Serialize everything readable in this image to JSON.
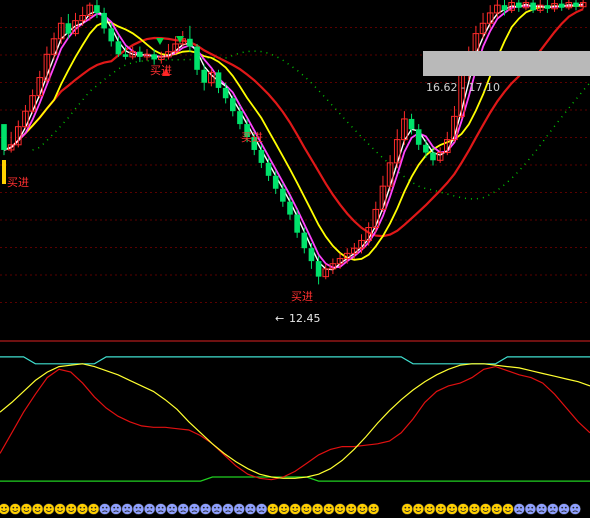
{
  "chart_data": {
    "type": "candlestick",
    "price_panel": {
      "ylim": [
        11.8,
        17.95
      ],
      "low_marker": "12.45",
      "range_box": "16.62 - 17.10",
      "signal_label": "买进",
      "up_candle_color": "#ff2b2b",
      "down_candle_color": "#00e26b",
      "candles": [
        [
          15.55,
          15.05,
          15.2,
          14.95
        ],
        [
          15.05,
          15.15,
          15.4,
          15.0
        ],
        [
          15.15,
          15.5,
          15.62,
          15.1
        ],
        [
          15.5,
          15.8,
          15.92,
          15.45
        ],
        [
          15.8,
          16.1,
          16.22,
          15.75
        ],
        [
          16.1,
          16.45,
          16.58,
          16.05
        ],
        [
          16.4,
          16.9,
          17.05,
          16.35
        ],
        [
          16.9,
          17.2,
          17.32,
          16.8
        ],
        [
          17.2,
          17.5,
          17.62,
          17.1
        ],
        [
          17.5,
          17.3,
          17.68,
          17.2
        ],
        [
          17.3,
          17.55,
          17.7,
          17.25
        ],
        [
          17.55,
          17.65,
          17.82,
          17.45
        ],
        [
          17.65,
          17.85,
          17.9,
          17.55
        ],
        [
          17.85,
          17.7,
          17.95,
          17.6
        ],
        [
          17.7,
          17.4,
          17.8,
          17.3
        ],
        [
          17.4,
          17.15,
          17.5,
          17.05
        ],
        [
          17.15,
          16.9,
          17.25,
          16.85
        ],
        [
          16.9,
          16.85,
          17.05,
          16.8
        ],
        [
          16.85,
          16.95,
          17.05,
          16.8
        ],
        [
          16.95,
          16.85,
          17.05,
          16.75
        ],
        [
          16.85,
          16.9,
          17.0,
          16.78
        ],
        [
          16.9,
          16.8,
          17.0,
          16.7
        ],
        [
          16.8,
          16.85,
          16.95,
          16.72
        ],
        [
          16.85,
          16.95,
          17.1,
          16.8
        ],
        [
          16.95,
          17.1,
          17.25,
          16.9
        ],
        [
          17.1,
          17.2,
          17.35,
          17.05
        ],
        [
          17.2,
          17.05,
          17.45,
          16.95
        ],
        [
          17.05,
          16.6,
          17.1,
          16.5
        ],
        [
          16.6,
          16.35,
          16.7,
          16.2
        ],
        [
          16.35,
          16.55,
          16.62,
          16.28
        ],
        [
          16.55,
          16.25,
          16.6,
          16.15
        ],
        [
          16.25,
          16.05,
          16.35,
          15.95
        ],
        [
          16.05,
          15.8,
          16.1,
          15.7
        ],
        [
          15.8,
          15.55,
          15.9,
          15.45
        ],
        [
          15.55,
          15.3,
          15.65,
          15.2
        ],
        [
          15.3,
          15.05,
          15.4,
          14.95
        ],
        [
          15.05,
          14.8,
          15.15,
          14.7
        ],
        [
          14.8,
          14.55,
          14.9,
          14.45
        ],
        [
          14.55,
          14.3,
          14.65,
          14.2
        ],
        [
          14.3,
          14.05,
          14.4,
          13.95
        ],
        [
          14.05,
          13.8,
          14.15,
          13.7
        ],
        [
          13.8,
          13.45,
          13.9,
          13.35
        ],
        [
          13.45,
          13.15,
          13.55,
          13.05
        ],
        [
          13.15,
          12.9,
          13.25,
          12.75
        ],
        [
          12.9,
          12.6,
          13.0,
          12.45
        ],
        [
          12.6,
          12.75,
          12.85,
          12.55
        ],
        [
          12.75,
          12.85,
          12.95,
          12.65
        ],
        [
          12.85,
          12.95,
          13.05,
          12.75
        ],
        [
          12.95,
          13.05,
          13.15,
          12.85
        ],
        [
          13.05,
          13.15,
          13.25,
          12.95
        ],
        [
          13.15,
          13.3,
          13.42,
          13.05
        ],
        [
          13.3,
          13.55,
          13.65,
          13.2
        ],
        [
          13.55,
          13.9,
          14.05,
          13.45
        ],
        [
          13.9,
          14.35,
          14.55,
          13.85
        ],
        [
          14.35,
          14.8,
          14.95,
          14.25
        ],
        [
          14.8,
          15.25,
          15.45,
          14.7
        ],
        [
          15.25,
          15.65,
          15.8,
          15.15
        ],
        [
          15.65,
          15.45,
          15.75,
          15.35
        ],
        [
          15.45,
          15.15,
          15.55,
          15.05
        ],
        [
          15.15,
          15.0,
          15.25,
          14.9
        ],
        [
          15.0,
          14.85,
          15.1,
          14.75
        ],
        [
          14.85,
          15.0,
          15.1,
          14.8
        ],
        [
          15.0,
          15.25,
          15.4,
          14.95
        ],
        [
          15.25,
          15.7,
          15.9,
          15.2
        ],
        [
          15.7,
          16.5,
          16.65,
          15.65
        ],
        [
          16.5,
          16.9,
          17.05,
          16.4
        ],
        [
          16.9,
          17.3,
          17.45,
          16.8
        ],
        [
          17.3,
          17.5,
          17.7,
          17.2
        ],
        [
          17.5,
          17.7,
          17.85,
          17.4
        ],
        [
          17.7,
          17.85,
          17.95,
          17.6
        ],
        [
          17.85,
          17.75,
          17.95,
          17.65
        ],
        [
          17.75,
          17.9,
          17.95,
          17.7
        ],
        [
          17.9,
          17.8,
          17.95,
          17.72
        ],
        [
          17.8,
          17.9,
          17.95,
          17.75
        ],
        [
          17.9,
          17.75,
          17.95,
          17.7
        ],
        [
          17.75,
          17.85,
          17.95,
          17.7
        ],
        [
          17.85,
          17.78,
          17.95,
          17.7
        ],
        [
          17.78,
          17.88,
          17.95,
          17.72
        ],
        [
          17.88,
          17.8,
          17.95,
          17.74
        ],
        [
          17.8,
          17.9,
          17.95,
          17.76
        ],
        [
          17.9,
          17.82,
          17.95,
          17.75
        ],
        [
          17.82,
          17.9,
          17.95,
          17.78
        ]
      ]
    },
    "oscillator_panel": {
      "ylim": [
        0,
        100
      ],
      "upper_level": 95,
      "lower_level": 5,
      "yellow_line": [
        55,
        62,
        70,
        78,
        84,
        88,
        89,
        90,
        88,
        85,
        82,
        78,
        74,
        70,
        64,
        57,
        48,
        40,
        32,
        25,
        19,
        14,
        10,
        8,
        7,
        7,
        8,
        10,
        14,
        20,
        28,
        37,
        47,
        56,
        64,
        71,
        77,
        82,
        86,
        89,
        90,
        90,
        89,
        88,
        87,
        85,
        83,
        81,
        79,
        77,
        74
      ],
      "red_line": [
        25,
        40,
        55,
        68,
        80,
        86,
        84,
        76,
        66,
        58,
        52,
        48,
        45,
        44,
        44,
        43,
        42,
        38,
        32,
        24,
        16,
        10,
        7,
        6,
        8,
        12,
        18,
        24,
        28,
        30,
        30,
        31,
        32,
        34,
        40,
        50,
        62,
        70,
        74,
        76,
        80,
        86,
        88,
        85,
        82,
        80,
        76,
        68,
        58,
        48,
        40
      ],
      "cyan_line": [
        95,
        95,
        95,
        95,
        95,
        95,
        95,
        95,
        95,
        95,
        95,
        95,
        95,
        95,
        95,
        95,
        95,
        95,
        95,
        95,
        95,
        95,
        95,
        95,
        95,
        95,
        95,
        95,
        95,
        95,
        95,
        95,
        95,
        95,
        95,
        95,
        95,
        95,
        95,
        95,
        95,
        95,
        95,
        95,
        95,
        95,
        95,
        95,
        95,
        95,
        95
      ],
      "green_line": [
        5,
        5,
        5,
        5,
        5,
        5,
        5,
        5,
        5,
        5,
        5,
        5,
        5,
        5,
        5,
        5,
        5,
        5,
        5,
        5,
        5,
        5,
        5,
        5,
        5,
        5,
        5,
        5,
        5,
        5,
        5,
        5,
        5,
        5,
        5,
        5,
        5,
        5,
        5,
        5,
        5,
        5,
        5,
        5,
        5,
        5,
        5,
        5,
        5,
        5,
        5
      ]
    }
  }
}
